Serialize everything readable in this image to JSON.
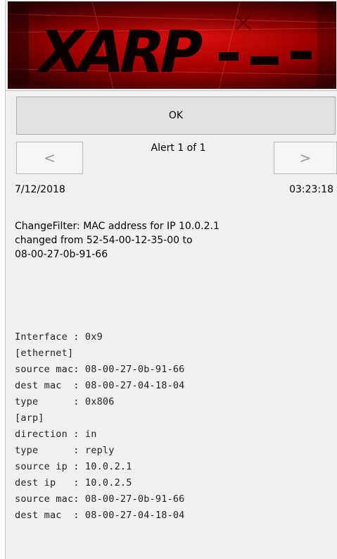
{
  "banner": {
    "logo_text": "XARP"
  },
  "actions": {
    "ok_label": "OK"
  },
  "navigation": {
    "prev_label": "<",
    "next_label": ">",
    "counter_text": "Alert 1 of 1"
  },
  "alert": {
    "date": "7/12/2018",
    "time": "03:23:18",
    "message_lines": [
      "ChangeFilter: MAC address for IP 10.0.2.1",
      "changed from 52-54-00-12-35-00 to",
      "08-00-27-0b-91-66"
    ]
  },
  "details": {
    "interface": "Interface : 0x9",
    "ethernet_header": "[ethernet]",
    "eth_source_mac": "source mac: 08-00-27-0b-91-66",
    "eth_dest_mac": "dest mac  : 08-00-27-04-18-04",
    "eth_type": "type      : 0x806",
    "arp_header": "[arp]",
    "arp_direction": "direction : in",
    "arp_type": "type      : reply",
    "arp_source_ip": "source ip : 10.0.2.1",
    "arp_dest_ip": "dest ip   : 10.0.2.5",
    "arp_source_mac": "source mac: 08-00-27-0b-91-66",
    "arp_dest_mac": "dest mac  : 08-00-27-04-18-04"
  },
  "colors": {
    "banner_red": "#c40000",
    "banner_dark": "#1a0000",
    "window_bg": "#f0f0f0"
  }
}
